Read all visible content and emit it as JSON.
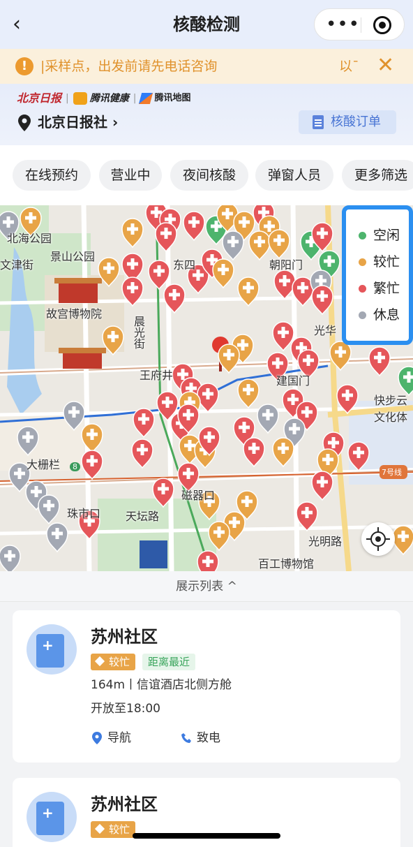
{
  "header": {
    "back_icon": "chevron-left-icon",
    "title": "核酸检测",
    "more_label": "•••"
  },
  "notice": {
    "icon": "!",
    "text": "|采样点，出发前请先电话咨询",
    "tail": "以¯",
    "close": "✕"
  },
  "brand": {
    "partner_a": "北京日报",
    "partner_b": "腾讯健康",
    "partner_c": "腾讯地图",
    "separator": "|"
  },
  "location": {
    "name": "北京日报社 ›",
    "order_button": "核酸订单"
  },
  "filters": [
    "在线预约",
    "营业中",
    "夜间核酸",
    "弹窗人员",
    "更多筛选"
  ],
  "legend": [
    {
      "label": "空闲",
      "color": "#4db46d"
    },
    {
      "label": "较忙",
      "color": "#e8a447"
    },
    {
      "label": "繁忙",
      "color": "#e5565a"
    },
    {
      "label": "休息",
      "color": "#a3a8b3"
    }
  ],
  "map_labels": {
    "beihai": "北海公园",
    "wenjin": "文津街",
    "jingshan": "景山公园",
    "gugong": "故宫博物院",
    "dongsi": "东四",
    "chaoyangmen": "朝阳门",
    "chenguang": "晨光街",
    "wangfujing": "王府井",
    "jianguomen": "建国门",
    "guanghua": "光华",
    "kuaibu": "快步云文化体",
    "dashilan": "大栅栏",
    "zhushikou": "珠市口",
    "tiantan": "天坛路",
    "ciqikou": "磁器口",
    "guangming": "光明路",
    "baigong": "百工博物馆",
    "line7": "7号线",
    "line8": "8"
  },
  "list_toggle": "展示列表 ^",
  "cards": [
    {
      "title": "苏州社区",
      "busy_badge": "较忙",
      "near_badge": "距离最近",
      "address": "164m丨信谊酒店北侧方舱",
      "open": "开放至18:00",
      "nav": "导航",
      "call": "致电"
    },
    {
      "title": "苏州社区",
      "busy_badge": "较忙"
    }
  ]
}
